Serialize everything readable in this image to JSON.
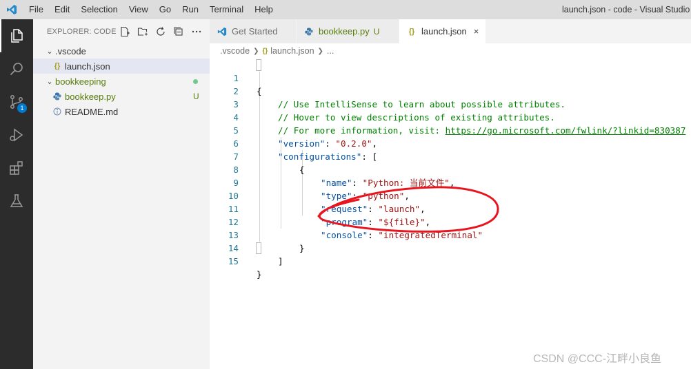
{
  "titlebar": {
    "menu": [
      "File",
      "Edit",
      "Selection",
      "View",
      "Go",
      "Run",
      "Terminal",
      "Help"
    ],
    "window_title": "launch.json - code - Visual Studio C"
  },
  "activity_bar": {
    "source_control_badge": "1"
  },
  "explorer": {
    "title": "EXPLORER: CODE",
    "items": [
      {
        "label": ".vscode",
        "type": "folder"
      },
      {
        "label": "launch.json",
        "type": "file",
        "icon": "{}"
      },
      {
        "label": "bookkeeping",
        "type": "folder"
      },
      {
        "label": "bookkeep.py",
        "type": "file",
        "status": "U"
      },
      {
        "label": "README.md",
        "type": "file"
      }
    ]
  },
  "tabs": [
    {
      "label": "Get Started"
    },
    {
      "label": "bookkeep.py",
      "status": "U"
    },
    {
      "label": "launch.json",
      "icon": "{}",
      "close": "×"
    }
  ],
  "breadcrumb": {
    "folder": ".vscode",
    "file": "launch.json",
    "more": "..."
  },
  "editor": {
    "line_numbers": [
      "1",
      "2",
      "3",
      "4",
      "5",
      "6",
      "7",
      "8",
      "9",
      "10",
      "11",
      "12",
      "13",
      "14",
      "15"
    ],
    "lines": {
      "l1": "{",
      "l2": "// Use IntelliSense to learn about possible attributes.",
      "l3": "// Hover to view descriptions of existing attributes.",
      "l4_text": "// For more information, visit: ",
      "l4_link": "https://go.microsoft.com/fwlink/?linkid=830387",
      "l5_key": "\"version\"",
      "l5_val": "\"0.2.0\"",
      "l6_key": "\"configurations\"",
      "l6_rest": ": [",
      "l7": "{",
      "l8_key": "\"name\"",
      "l8_val": "\"Python: 当前文件\"",
      "l9_key": "\"type\"",
      "l9_val": "\"python\"",
      "l10_key": "\"request\"",
      "l10_val": "\"launch\"",
      "l11_key": "\"program\"",
      "l11_val": "\"${file}\"",
      "l12_key": "\"console\"",
      "l12_val": "\"integratedTerminal\"",
      "l13": "}",
      "l14": "]",
      "l15": "}"
    }
  },
  "watermark": "CSDN @CCC-江畔小良鱼",
  "colors": {
    "accent": "#007acc",
    "annotation": "#e8151f",
    "comment": "#008000",
    "json_key": "#0451a5",
    "json_string": "#a31515"
  }
}
